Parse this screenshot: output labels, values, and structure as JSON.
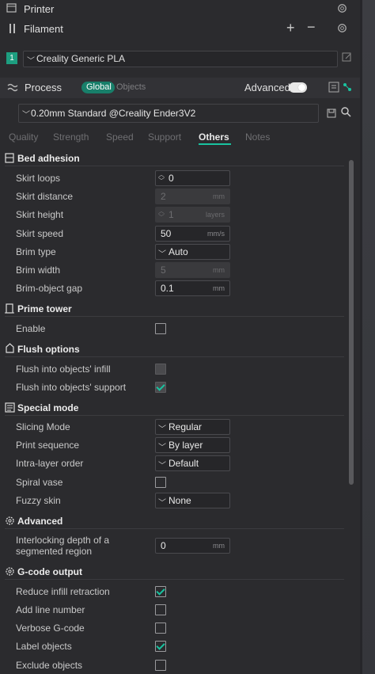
{
  "printer": {
    "label": "Printer"
  },
  "filament": {
    "label": "Filament",
    "slot": "1",
    "name": "Creality Generic PLA",
    "slot_color": "#1d9e80"
  },
  "process": {
    "label": "Process",
    "global_label": "Global",
    "objects_label": "Objects",
    "advanced_label": "Advanced",
    "profile": "0.20mm Standard @Creality Ender3V2"
  },
  "tabs": [
    "Quality",
    "Strength",
    "Speed",
    "Support",
    "Others",
    "Notes"
  ],
  "active_tab": "Others",
  "sections": {
    "bed_adhesion": {
      "title": "Bed adhesion",
      "skirt_loops": {
        "label": "Skirt loops",
        "value": "0"
      },
      "skirt_distance": {
        "label": "Skirt distance",
        "value": "2",
        "unit": "mm"
      },
      "skirt_height": {
        "label": "Skirt height",
        "value": "1",
        "unit": "layers"
      },
      "skirt_speed": {
        "label": "Skirt speed",
        "value": "50",
        "unit": "mm/s"
      },
      "brim_type": {
        "label": "Brim type",
        "value": "Auto"
      },
      "brim_width": {
        "label": "Brim width",
        "value": "5",
        "unit": "mm"
      },
      "brim_object_gap": {
        "label": "Brim-object gap",
        "value": "0.1",
        "unit": "mm"
      }
    },
    "prime_tower": {
      "title": "Prime tower",
      "enable": {
        "label": "Enable",
        "checked": false
      }
    },
    "flush_options": {
      "title": "Flush options",
      "infill": {
        "label": "Flush into objects' infill",
        "checked": false
      },
      "support": {
        "label": "Flush into objects' support",
        "checked": true
      }
    },
    "special_mode": {
      "title": "Special mode",
      "slicing_mode": {
        "label": "Slicing Mode",
        "value": "Regular"
      },
      "print_sequence": {
        "label": "Print sequence",
        "value": "By layer"
      },
      "intra_layer_order": {
        "label": "Intra-layer order",
        "value": "Default"
      },
      "spiral_vase": {
        "label": "Spiral vase",
        "checked": false
      },
      "fuzzy_skin": {
        "label": "Fuzzy skin",
        "value": "None"
      }
    },
    "advanced": {
      "title": "Advanced",
      "interlocking_line1": "Interlocking depth of a",
      "interlocking_line2": "segmented region",
      "interlocking_value": "0",
      "interlocking_unit": "mm"
    },
    "gcode_output": {
      "title": "G-code output",
      "reduce_infill_retraction": {
        "label": "Reduce infill retraction",
        "checked": true
      },
      "add_line_number": {
        "label": "Add line number",
        "checked": false
      },
      "verbose_gcode": {
        "label": "Verbose G-code",
        "checked": false
      },
      "label_objects": {
        "label": "Label objects",
        "checked": true
      },
      "exclude_objects": {
        "label": "Exclude objects",
        "checked": false
      }
    }
  },
  "colors": {
    "accent": "#19c3a0",
    "panel_bg": "#2b2b2e"
  }
}
